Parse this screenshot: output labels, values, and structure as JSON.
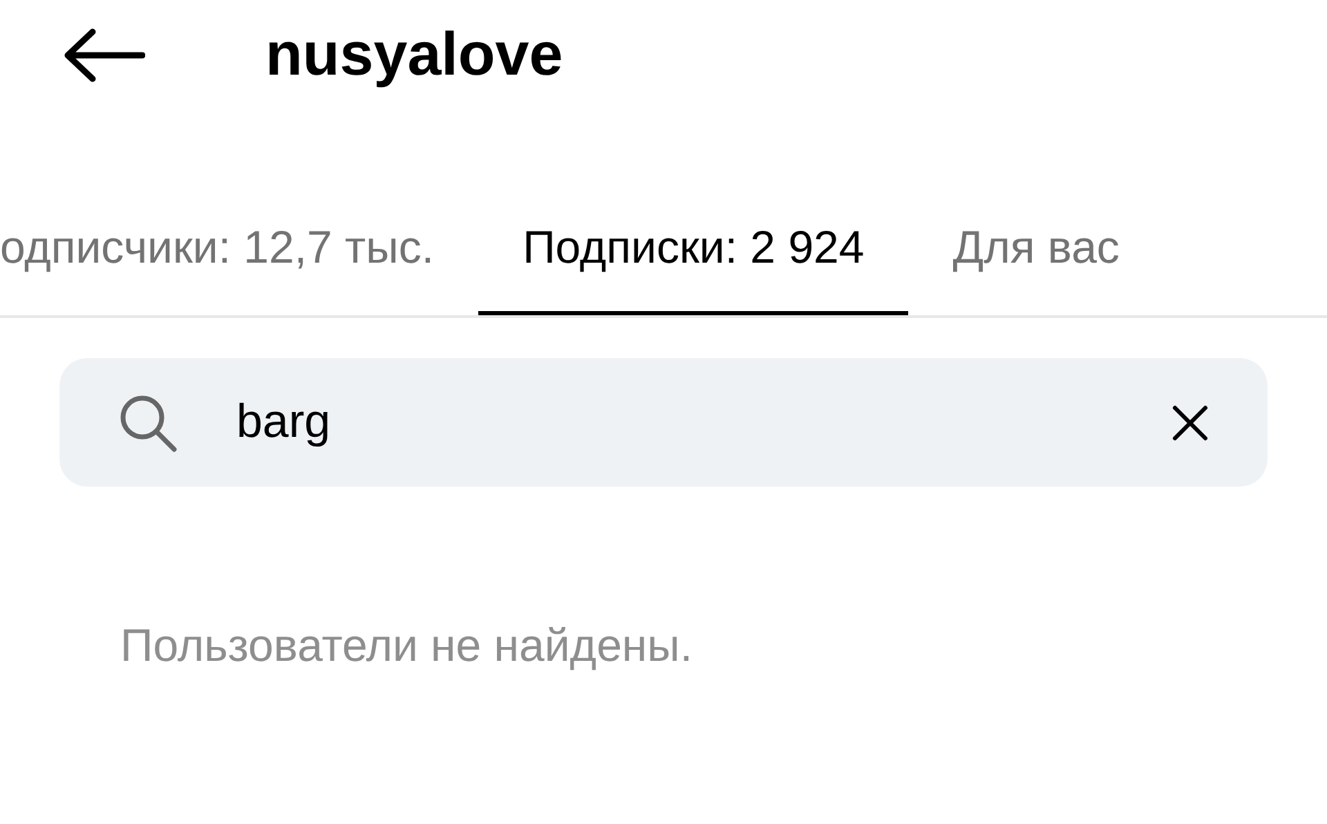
{
  "header": {
    "title": "nusyalove"
  },
  "tabs": [
    {
      "label": "одписчики: 12,7 тыс.",
      "selected": false
    },
    {
      "label": "Подписки: 2 924",
      "selected": true
    },
    {
      "label": "Для вас",
      "selected": false
    }
  ],
  "search": {
    "value": "barg"
  },
  "empty_message": "Пользователи не найдены."
}
